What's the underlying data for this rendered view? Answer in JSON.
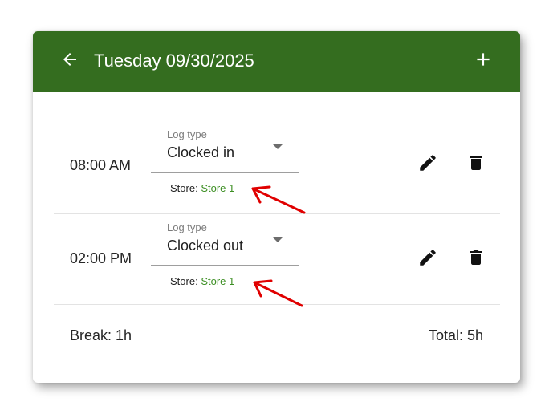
{
  "header": {
    "title": "Tuesday 09/30/2025",
    "back_icon": "arrow-left-icon",
    "add_icon": "plus-icon",
    "background_color": "#346d1f"
  },
  "entries": [
    {
      "time": "08:00 AM",
      "log_type_label": "Log type",
      "log_type_value": "Clocked in",
      "store_label": "Store:",
      "store_name": "Store 1",
      "edit_icon": "pencil-icon",
      "delete_icon": "trash-icon"
    },
    {
      "time": "02:00 PM",
      "log_type_label": "Log type",
      "log_type_value": "Clocked out",
      "store_label": "Store:",
      "store_name": "Store 1",
      "edit_icon": "pencil-icon",
      "delete_icon": "trash-icon"
    }
  ],
  "footer": {
    "break": "Break: 1h",
    "total": "Total: 5h"
  },
  "annotations": {
    "arrow_color": "#e00000"
  },
  "colors": {
    "store_link": "#3d8f24"
  }
}
